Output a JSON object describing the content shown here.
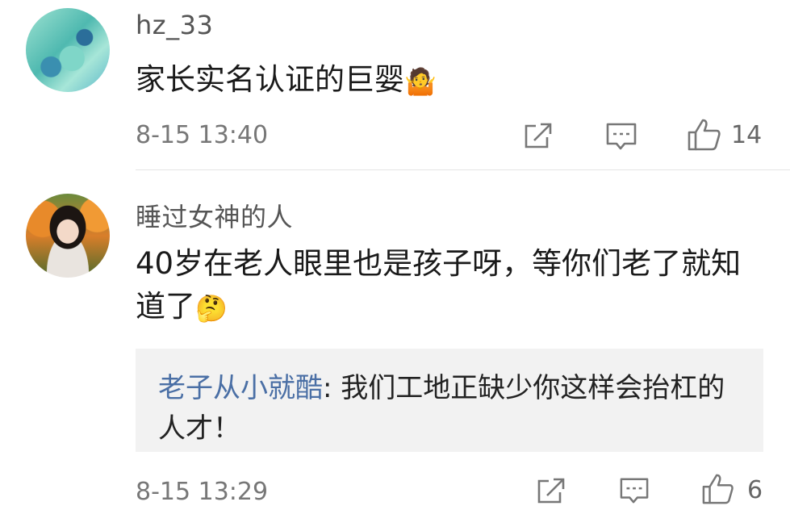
{
  "comments": [
    {
      "username": "hz_33",
      "text": "家长实名认证的巨婴",
      "emoji": "🤷",
      "time": "8-15 13:40",
      "likes": "14"
    },
    {
      "username": "睡过女神的人",
      "text": "40岁在老人眼里也是孩子呀，等你们老了就知道了",
      "emoji": "🤔",
      "time": "8-15 13:29",
      "likes": "6",
      "reply": {
        "author": "老子从小就酷",
        "separator": ": ",
        "text": "我们工地正缺少你这样会抬杠的人才！"
      }
    }
  ],
  "icons": {
    "share": "share-icon",
    "comment": "comment-icon",
    "like": "thumbs-up-icon"
  },
  "colors": {
    "reply_author": "#4a6fa5",
    "reply_bg": "#f2f2f2"
  }
}
